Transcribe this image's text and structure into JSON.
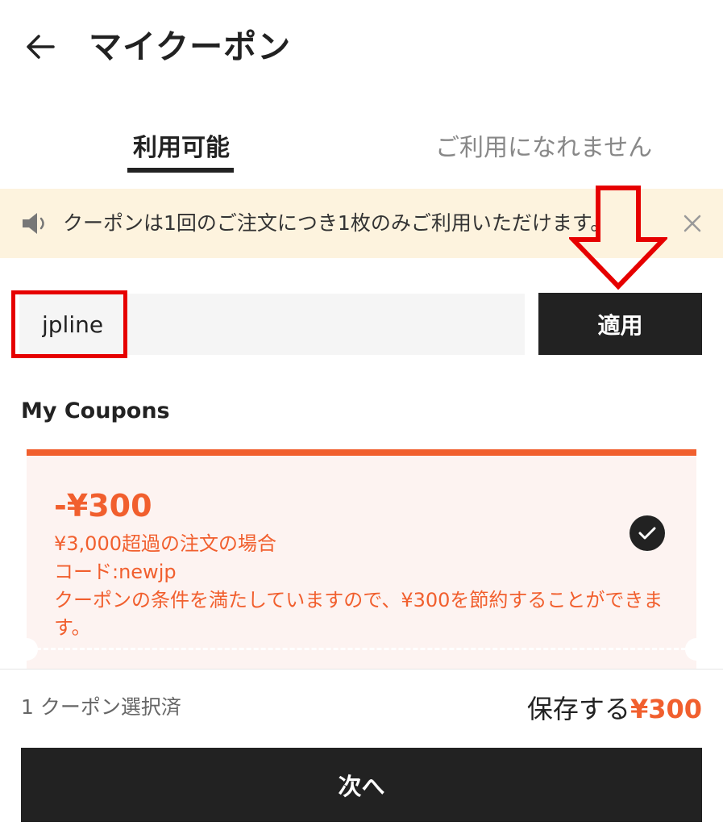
{
  "header": {
    "title": "マイクーポン",
    "back_icon": "arrow-left-icon"
  },
  "tabs": [
    {
      "label": "利用可能",
      "active": true
    },
    {
      "label": "ご利用になれません",
      "active": false
    }
  ],
  "notice": {
    "text": "クーポンは1回のご注文につき1枚のみご利用いただけます。",
    "icon": "speaker-icon",
    "close_icon": "close-icon"
  },
  "code_entry": {
    "value": "jpline",
    "apply_label": "適用"
  },
  "section_title": "My Coupons",
  "coupon": {
    "amount": "-¥300",
    "condition": "¥3,000超過の注文の場合",
    "code": "コード:newjp",
    "message": "クーポンの条件を満たしていますので、¥300を節約することができます。",
    "selected": true
  },
  "footer": {
    "selected_count": "1 クーポン選択済",
    "save_label": "保存する",
    "save_amount": "¥300",
    "next_label": "次へ"
  },
  "colors": {
    "accent": "#f15f2e",
    "dark": "#222222",
    "notice_bg": "#fdf3de",
    "coupon_bg": "#fdf3f1",
    "annotation_red": "#e60000"
  }
}
